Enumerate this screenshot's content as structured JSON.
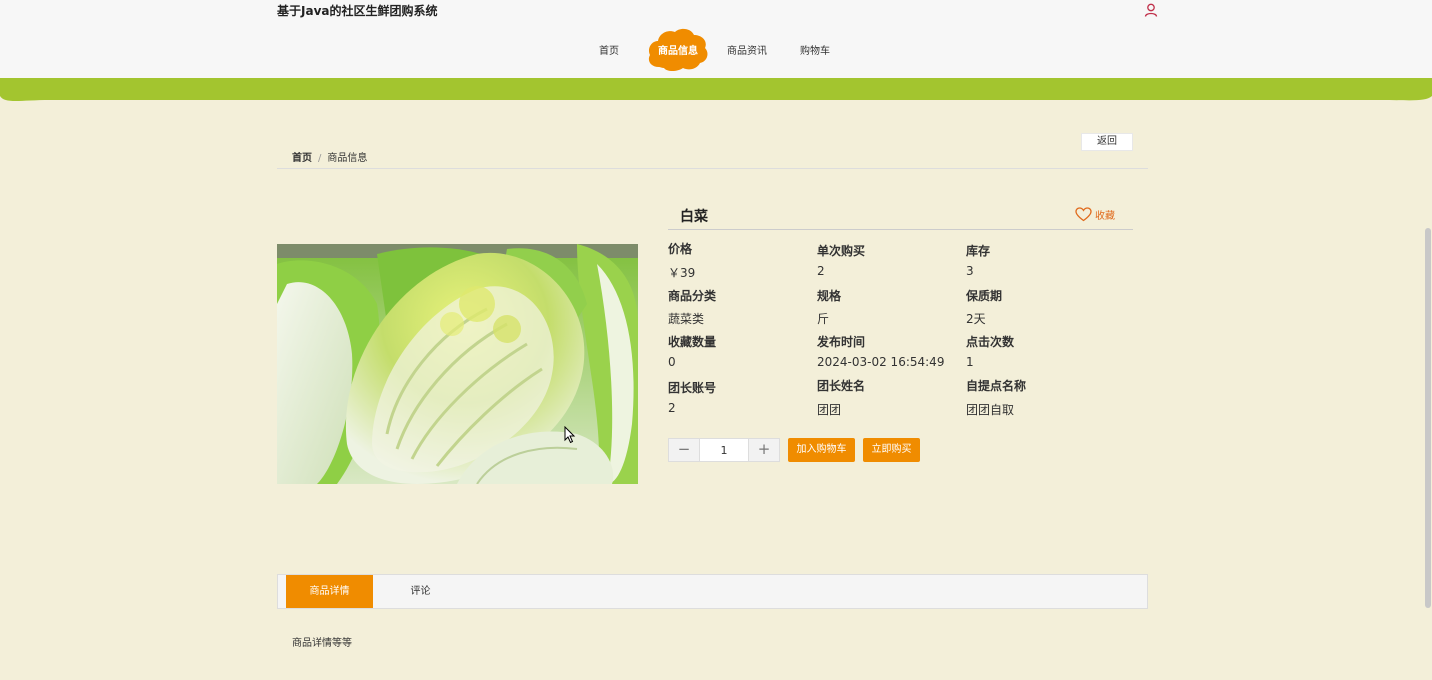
{
  "header": {
    "site_title": "基于Java的社区生鲜团购系统",
    "nav": [
      {
        "label": "首页",
        "active": false
      },
      {
        "label": "商品信息",
        "active": true
      },
      {
        "label": "商品资讯",
        "active": false
      },
      {
        "label": "购物车",
        "active": false
      }
    ]
  },
  "colors": {
    "accent": "#f08c00",
    "green": "#a3c52f",
    "background": "#f3efd9",
    "favorite": "#e06a1c"
  },
  "content": {
    "return_label": "返回",
    "breadcrumb": {
      "home": "首页",
      "current": "商品信息"
    },
    "product": {
      "name": "白菜",
      "favorite_label": "收藏",
      "attributes": [
        {
          "label": "价格",
          "value": "￥39"
        },
        {
          "label": "单次购买",
          "value": "2"
        },
        {
          "label": "库存",
          "value": "3"
        },
        {
          "label": "商品分类",
          "value": "蔬菜类"
        },
        {
          "label": "规格",
          "value": "斤"
        },
        {
          "label": "保质期",
          "value": "2天"
        },
        {
          "label": "收藏数量",
          "value": "0"
        },
        {
          "label": "发布时间",
          "value": "2024-03-02 16:54:49"
        },
        {
          "label": "点击次数",
          "value": "1"
        },
        {
          "label": "团长账号",
          "value": "2"
        },
        {
          "label": "团长姓名",
          "value": "团团"
        },
        {
          "label": "自提点名称",
          "value": "团团自取"
        }
      ],
      "quantity": "1",
      "add_to_cart_label": "加入购物车",
      "buy_now_label": "立即购买"
    },
    "tabs": [
      {
        "label": "商品详情",
        "active": true
      },
      {
        "label": "评论",
        "active": false
      }
    ],
    "detail_text": "商品详情等等"
  }
}
